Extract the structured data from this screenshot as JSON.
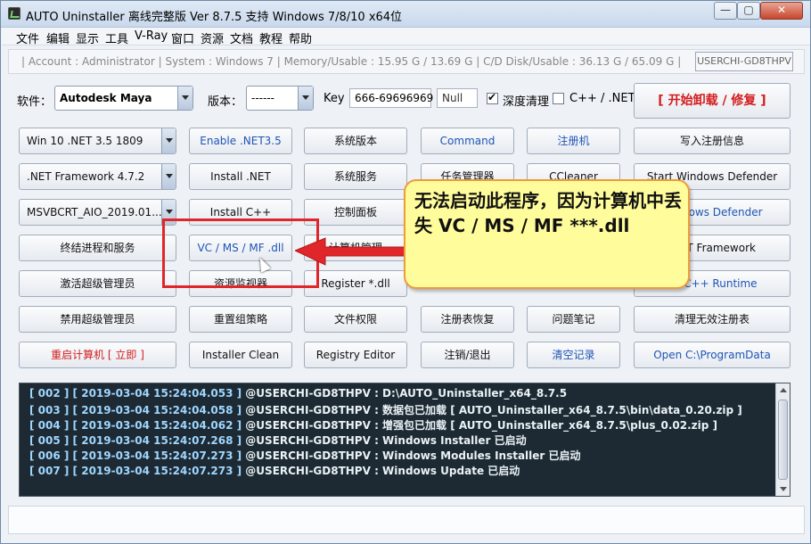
{
  "window": {
    "title": "AUTO Uninstaller 离线完整版 Ver 8.7.5 支持 Windows 7/8/10 x64位",
    "controls": {
      "minimize": "—",
      "maximize": "▢",
      "close": "✕"
    }
  },
  "menu": [
    "文件",
    "编辑",
    "显示",
    "工具",
    "V-Ray",
    "窗口",
    "资源",
    "文档",
    "教程",
    "帮助"
  ],
  "status": {
    "info": "| Account : Administrator  |  System : Windows 7  |  Memory/Usable : 15.95 G / 13.69 G  |  C/D Disk/Usable : 36.13 G / 65.09 G  |",
    "host": "USERCHI-GD8THPV"
  },
  "controls": {
    "software_label": "软件：",
    "software_value": "Autodesk Maya",
    "version_label": "版本：",
    "version_value": "------",
    "key_label": "Key",
    "key_value": "666-69696969",
    "null_value": "Null",
    "deep_clean_label": "深度清理",
    "deep_clean_checked": true,
    "cpp_net_label": "C++ / .NET",
    "cpp_net_checked": false,
    "start_label": "[  开始卸载 / 修复  ]"
  },
  "buttons": {
    "row1": [
      "Win 10 .NET 3.5 1809",
      "Enable .NET3.5",
      "系统版本",
      "Command",
      "注册机",
      "写入注册信息"
    ],
    "row2": [
      ".NET Framework 4.7.2",
      "Install .NET",
      "系统服务",
      "任务管理器",
      "CCleaner",
      "Start  Windows Defender"
    ],
    "row3": [
      "MSVBCRT_AIO_2019.01...",
      "Install C++",
      "控制面板",
      "",
      "",
      "Windows Defender"
    ],
    "row4": [
      "终结进程和服务",
      "VC / MS / MF .dll",
      "计算机管理",
      "",
      "",
      ".NET Framework"
    ],
    "row5": [
      "激活超级管理员",
      "资源监视器",
      "Register *.dll",
      "",
      "",
      "All C++ Runtime"
    ],
    "row6": [
      "禁用超级管理员",
      "重置组策略",
      "文件权限",
      "注册表恢复",
      "问题笔记",
      "清理无效注册表"
    ],
    "row7": [
      "重启计算机 [ 立即 ]",
      "Installer Clean",
      "Registry Editor",
      "注销/退出",
      "清空记录",
      "Open C:\\ProgramData"
    ]
  },
  "log": [
    {
      "prefix": "[ 002 ] [ 2019-03-04 15:24:04.053 ]",
      "text": " @USERCHI-GD8THPV : D:\\AUTO_Uninstaller_x64_8.7.5"
    },
    {
      "prefix": "[ 003 ] [ 2019-03-04 15:24:04.058 ]",
      "text": " @USERCHI-GD8THPV : 数据包已加载 [ AUTO_Uninstaller_x64_8.7.5\\bin\\data_0.20.zip ]"
    },
    {
      "prefix": "[ 004 ] [ 2019-03-04 15:24:04.062 ]",
      "text": " @USERCHI-GD8THPV : 增强包已加载 [ AUTO_Uninstaller_x64_8.7.5\\plus_0.02.zip ]"
    },
    {
      "prefix": "[ 005 ] [ 2019-03-04 15:24:07.268 ]",
      "text": " @USERCHI-GD8THPV : Windows Installer 已启动"
    },
    {
      "prefix": "[ 006 ] [ 2019-03-04 15:24:07.273 ]",
      "text": " @USERCHI-GD8THPV : Windows Modules Installer 已启动"
    },
    {
      "prefix": "[ 007 ] [ 2019-03-04 15:24:07.273 ]",
      "text": " @USERCHI-GD8THPV : Windows Update 已启动"
    }
  ],
  "callout": {
    "text": "无法启动此程序，因为计算机中丢失 VC / MS / MF ***.dll"
  },
  "colors": {
    "accent_red": "#e0262a",
    "callout_bg": "#fffc9c",
    "log_bg": "#1e2a33",
    "blue_text": "#1f55b5"
  }
}
